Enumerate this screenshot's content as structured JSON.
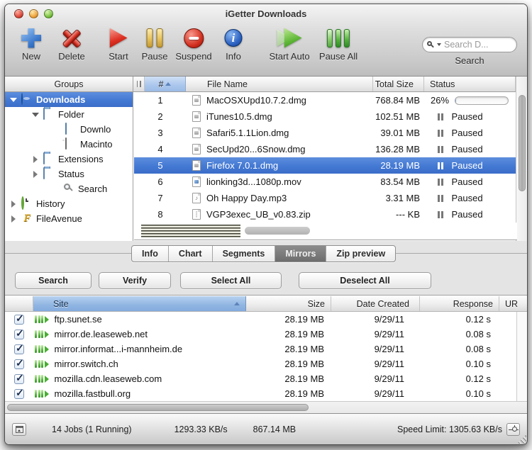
{
  "window": {
    "title": "iGetter Downloads"
  },
  "colors": {
    "selection_blue": "#4277d2",
    "sorted_header_blue": "#aac6ec",
    "mirror_site_header_blue": "#90b5e2",
    "progress_fill_blue": "#97c2ea",
    "mirror_icon_green": "#55b23b",
    "chrome_gray": "#d6d6d6"
  },
  "toolbar": {
    "buttons": [
      {
        "label": "New",
        "icon": "plus-icon"
      },
      {
        "label": "Delete",
        "icon": "red-x-icon"
      },
      {
        "label": "Start",
        "icon": "play-icon"
      },
      {
        "label": "Pause",
        "icon": "pause-bars-icon"
      },
      {
        "label": "Suspend",
        "icon": "minus-circle-icon"
      },
      {
        "label": "Info",
        "icon": "info-circle-icon"
      },
      {
        "label": "Start Auto",
        "icon": "double-play-icon"
      },
      {
        "label": "Pause All",
        "icon": "green-pause-bars-icon"
      }
    ],
    "search": {
      "placeholder": "Search D...",
      "label": "Search",
      "icon": "magnifier-icon"
    }
  },
  "sidebar": {
    "header": "Groups",
    "items": [
      {
        "label": "Downloads",
        "icon": "globe-icon",
        "disclosure": "down",
        "selected": true
      },
      {
        "label": "Folder",
        "icon": "folder-icon",
        "disclosure": "down"
      },
      {
        "label": "Downlo",
        "icon": "download-folder-icon",
        "disclosure": "none"
      },
      {
        "label": "Macinto",
        "icon": "hard-drive-icon",
        "disclosure": "none"
      },
      {
        "label": "Extensions",
        "icon": "folder-icon",
        "disclosure": "right"
      },
      {
        "label": "Status",
        "icon": "folder-icon",
        "disclosure": "right"
      },
      {
        "label": "Search",
        "icon": "magnifier-icon",
        "disclosure": "none"
      },
      {
        "label": "History",
        "icon": "clock-icon",
        "disclosure": "right"
      },
      {
        "label": "FileAvenue",
        "icon": "fileavenue-icon",
        "disclosure": "right"
      }
    ]
  },
  "downloads_table": {
    "columns": {
      "num": "#",
      "name": "File Name",
      "size": "Total Size",
      "status": "Status"
    },
    "sort_column": "#",
    "rows": [
      {
        "num": "1",
        "name": "MacOSXUpd10.7.2.dmg",
        "size": "768.84 MB",
        "status": "26%",
        "progress_pct": 26,
        "icon": "dmg-file-icon"
      },
      {
        "num": "2",
        "name": "iTunes10.5.dmg",
        "size": "102.51 MB",
        "status": "Paused",
        "icon": "dmg-file-icon"
      },
      {
        "num": "3",
        "name": "Safari5.1.1Lion.dmg",
        "size": "39.01 MB",
        "status": "Paused",
        "icon": "dmg-file-icon"
      },
      {
        "num": "4",
        "name": "SecUpd20...6Snow.dmg",
        "size": "136.28 MB",
        "status": "Paused",
        "icon": "dmg-file-icon"
      },
      {
        "num": "5",
        "name": "Firefox 7.0.1.dmg",
        "size": "28.19 MB",
        "status": "Paused",
        "selected": true,
        "icon": "dmg-file-icon"
      },
      {
        "num": "6",
        "name": "lionking3d...1080p.mov",
        "size": "83.54 MB",
        "status": "Paused",
        "icon": "movie-file-icon"
      },
      {
        "num": "7",
        "name": "Oh Happy Day.mp3",
        "size": "3.31 MB",
        "status": "Paused",
        "icon": "music-file-icon"
      },
      {
        "num": "8",
        "name": "VGP3exec_UB_v0.83.zip",
        "size": "--- KB",
        "status": "Paused",
        "icon": "zip-file-icon"
      }
    ]
  },
  "tabs": {
    "items": [
      {
        "label": "Info"
      },
      {
        "label": "Chart"
      },
      {
        "label": "Segments"
      },
      {
        "label": "Mirrors",
        "active": true
      },
      {
        "label": "Zip preview"
      }
    ]
  },
  "mirror_buttons": [
    {
      "label": "Search"
    },
    {
      "label": "Verify"
    },
    {
      "label": "Select All"
    },
    {
      "label": "Deselect All"
    }
  ],
  "mirrors_table": {
    "columns": {
      "site": "Site",
      "size": "Size",
      "date": "Date Created",
      "response": "Response",
      "url": "UR"
    },
    "sort_column": "Site",
    "rows": [
      {
        "checked": true,
        "site": "ftp.sunet.se",
        "size": "28.19 MB",
        "date": "9/29/11",
        "response": "0.12 s",
        "icon": "mirror-server-icon"
      },
      {
        "checked": true,
        "site": "mirror.de.leaseweb.net",
        "size": "28.19 MB",
        "date": "9/29/11",
        "response": "0.08 s",
        "icon": "mirror-server-icon"
      },
      {
        "checked": true,
        "site": "mirror.informat...i-mannheim.de",
        "size": "28.19 MB",
        "date": "9/29/11",
        "response": "0.08 s",
        "icon": "mirror-server-icon"
      },
      {
        "checked": true,
        "site": "mirror.switch.ch",
        "size": "28.19 MB",
        "date": "9/29/11",
        "response": "0.10 s",
        "icon": "mirror-server-icon"
      },
      {
        "checked": true,
        "site": "mozilla.cdn.leaseweb.com",
        "size": "28.19 MB",
        "date": "9/29/11",
        "response": "0.12 s",
        "icon": "mirror-server-icon"
      },
      {
        "checked": true,
        "site": "mozilla.fastbull.org",
        "size": "28.19 MB",
        "date": "9/29/11",
        "response": "0.10 s",
        "icon": "mirror-server-icon"
      }
    ]
  },
  "statusbar": {
    "jobs": "14 Jobs (1 Running)",
    "speed": "1293.33 KB/s",
    "total": "867.14 MB",
    "speed_limit": "Speed Limit: 1305.63 KB/s",
    "left_icon": "panel-toggle-icon",
    "right_icon": "speed-slider-icon"
  }
}
